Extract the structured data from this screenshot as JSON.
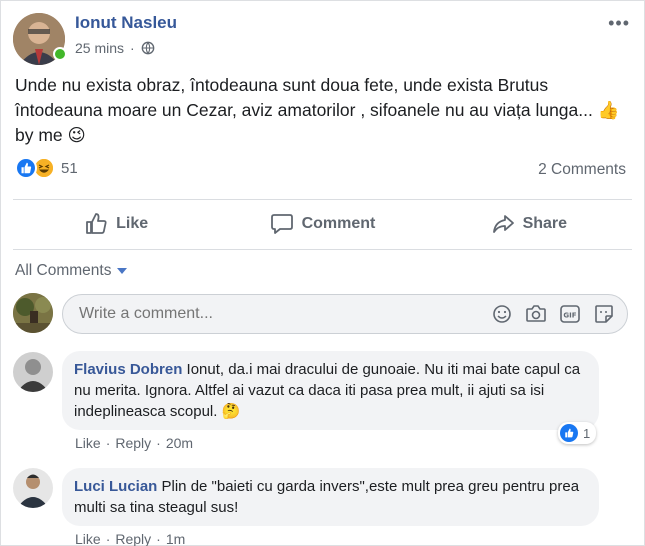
{
  "post": {
    "author": "Ionut Nasleu",
    "time": "25 mins",
    "privacy_icon": "globe-icon",
    "more_label": "•••",
    "text": "Unde nu exista obraz, întodeauna sunt doua fete, unde exista Brutus întodeauna moare un Cezar, aviz amatorilor , sifoanele nu au viața lunga... 👍 by me 😉",
    "reaction_icons": [
      "like-icon",
      "haha-icon"
    ],
    "reaction_count": "51",
    "comments_count": "2 Comments"
  },
  "actions": {
    "like": "Like",
    "comment": "Comment",
    "share": "Share"
  },
  "comments_section": {
    "filter_label": "All Comments",
    "write_placeholder": "Write a comment...",
    "write_icons": [
      "emoji-icon",
      "camera-icon",
      "gif-icon",
      "sticker-icon"
    ]
  },
  "comments": [
    {
      "name": "Flavius Dobren",
      "text": "Ionut, da.i mai dracului de gunoaie. Nu iti mai bate capul ca nu merita. Ignora. Altfel ai vazut ca daca iti pasa prea mult, ii ajuti sa isi indeplineasca scopul. 🤔",
      "like_label": "Like",
      "reply_label": "Reply",
      "time": "20m",
      "reaction_count": "1"
    },
    {
      "name": "Luci Lucian",
      "text": "Plin de \"baieti cu garda invers\",este mult prea greu pentru prea multi sa tina steagul sus!",
      "like_label": "Like",
      "reply_label": "Reply",
      "time": "1m"
    }
  ],
  "colors": {
    "link_blue": "#365899",
    "like_blue": "#1877f2",
    "online_green": "#42b72a",
    "haha_yellow": "#f7b125",
    "bubble_gray": "#f2f3f5"
  }
}
